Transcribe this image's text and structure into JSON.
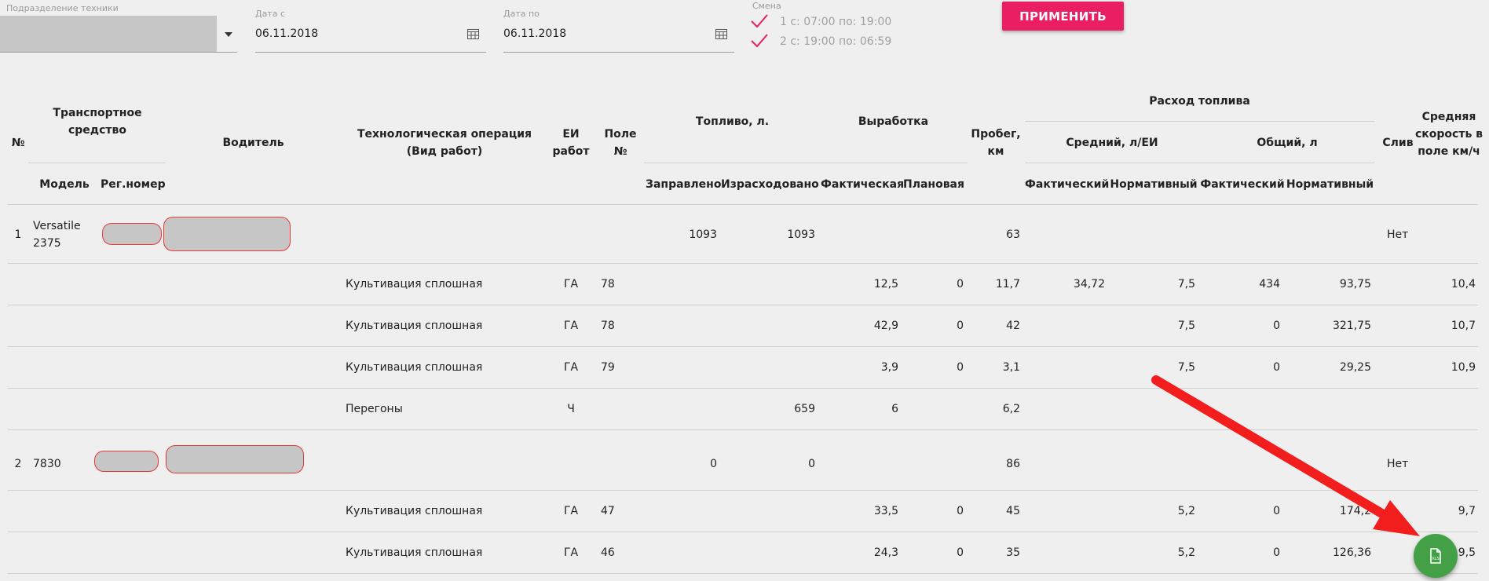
{
  "filters": {
    "department_label": "Подразделение техники",
    "date_from_label": "Дата с",
    "date_from_value": "06.11.2018",
    "date_to_label": "Дата по",
    "date_to_value": "06.11.2018",
    "shift_label": "Смена",
    "shift1": "1 с: 07:00 по: 19:00",
    "shift2": "2 с: 19:00 по: 06:59",
    "apply_label": "ПРИМЕНИТЬ"
  },
  "headers": {
    "num": "№",
    "vehicle": "Транспортное средство",
    "model": "Модель",
    "reg": "Рег.номер",
    "driver": "Водитель",
    "operation": "Технологическая операция (Вид работ)",
    "unit": "ЕИ работ",
    "field": "Поле №",
    "fuel": "Топливо, л.",
    "filled": "Заправлено",
    "spent": "Израсходовано",
    "output": "Выработка",
    "actual": "Фактическая",
    "planned": "Плановая",
    "mileage": "Пробег, км",
    "consumption": "Расход топлива",
    "avg": "Средний, л/ЕИ",
    "total": "Общий, л",
    "fact": "Фактический",
    "norm": "Нормативный",
    "drain": "Слив",
    "speed": "Средняя скорость в поле км/ч"
  },
  "rows": [
    {
      "num": "1",
      "model": "Versatile 2375",
      "op": "",
      "unit": "",
      "field": "",
      "filled": "1093",
      "spent": "1093",
      "out_fact": "",
      "out_plan": "",
      "mileage": "63",
      "avg_fact": "",
      "avg_norm": "",
      "tot_fact": "",
      "tot_norm": "",
      "drain": "Нет",
      "speed": ""
    },
    {
      "num": "",
      "model": "",
      "op": "Культивация сплошная",
      "unit": "ГА",
      "field": "78",
      "filled": "",
      "spent": "",
      "out_fact": "12,5",
      "out_plan": "0",
      "mileage": "11,7",
      "avg_fact": "34,72",
      "avg_norm": "7,5",
      "tot_fact": "434",
      "tot_norm": "93,75",
      "drain": "",
      "speed": "10,4"
    },
    {
      "num": "",
      "model": "",
      "op": "Культивация сплошная",
      "unit": "ГА",
      "field": "78",
      "filled": "",
      "spent": "",
      "out_fact": "42,9",
      "out_plan": "0",
      "mileage": "42",
      "avg_fact": "",
      "avg_norm": "7,5",
      "tot_fact": "0",
      "tot_norm": "321,75",
      "drain": "",
      "speed": "10,7"
    },
    {
      "num": "",
      "model": "",
      "op": "Культивация сплошная",
      "unit": "ГА",
      "field": "79",
      "filled": "",
      "spent": "",
      "out_fact": "3,9",
      "out_plan": "0",
      "mileage": "3,1",
      "avg_fact": "",
      "avg_norm": "7,5",
      "tot_fact": "0",
      "tot_norm": "29,25",
      "drain": "",
      "speed": "10,9"
    },
    {
      "num": "",
      "model": "",
      "op": "Перегоны",
      "unit": "Ч",
      "field": "",
      "filled": "",
      "spent": "659",
      "out_fact": "6",
      "out_plan": "",
      "mileage": "6,2",
      "avg_fact": "",
      "avg_norm": "",
      "tot_fact": "",
      "tot_norm": "",
      "drain": "",
      "speed": ""
    },
    {
      "num": "2",
      "model": "7830",
      "op": "",
      "unit": "",
      "field": "",
      "filled": "0",
      "spent": "0",
      "out_fact": "",
      "out_plan": "",
      "mileage": "86",
      "avg_fact": "",
      "avg_norm": "",
      "tot_fact": "",
      "tot_norm": "",
      "drain": "Нет",
      "speed": ""
    },
    {
      "num": "",
      "model": "",
      "op": "Культивация сплошная",
      "unit": "ГА",
      "field": "47",
      "filled": "",
      "spent": "",
      "out_fact": "33,5",
      "out_plan": "0",
      "mileage": "45",
      "avg_fact": "",
      "avg_norm": "5,2",
      "tot_fact": "0",
      "tot_norm": "174,2",
      "drain": "",
      "speed": "9,7"
    },
    {
      "num": "",
      "model": "",
      "op": "Культивация сплошная",
      "unit": "ГА",
      "field": "46",
      "filled": "",
      "spent": "",
      "out_fact": "24,3",
      "out_plan": "0",
      "mileage": "35",
      "avg_fact": "",
      "avg_norm": "5,2",
      "tot_fact": "0",
      "tot_norm": "126,36",
      "drain": "",
      "speed": "9,5"
    }
  ],
  "colors": {
    "accent": "#e91e63",
    "fab": "#43a047",
    "arrow": "#f21d1d"
  },
  "icons": {
    "calendar": "calendar-icon",
    "check": "checkmark-icon",
    "export": "xls-export-icon"
  }
}
